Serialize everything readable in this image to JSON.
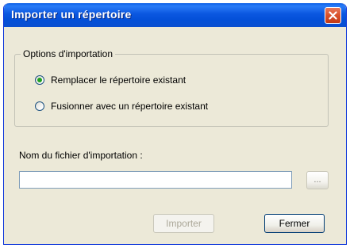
{
  "window": {
    "title": "Importer un répertoire"
  },
  "options_group": {
    "legend": "Options d'importation",
    "radios": [
      {
        "label": "Remplacer le répertoire existant",
        "checked": true
      },
      {
        "label": "Fusionner avec un répertoire existant",
        "checked": false
      }
    ]
  },
  "file_field": {
    "label": "Nom du fichier d'importation :",
    "value": "",
    "browse_label": "..."
  },
  "buttons": {
    "import_label": "Importer",
    "close_label": "Fermer"
  },
  "icons": {
    "close": "close-icon"
  },
  "colors": {
    "titlebar": "#0b57e0",
    "close_button": "#d9512a",
    "dialog_bg": "#ece9d8",
    "radio_dot": "#21a121"
  }
}
